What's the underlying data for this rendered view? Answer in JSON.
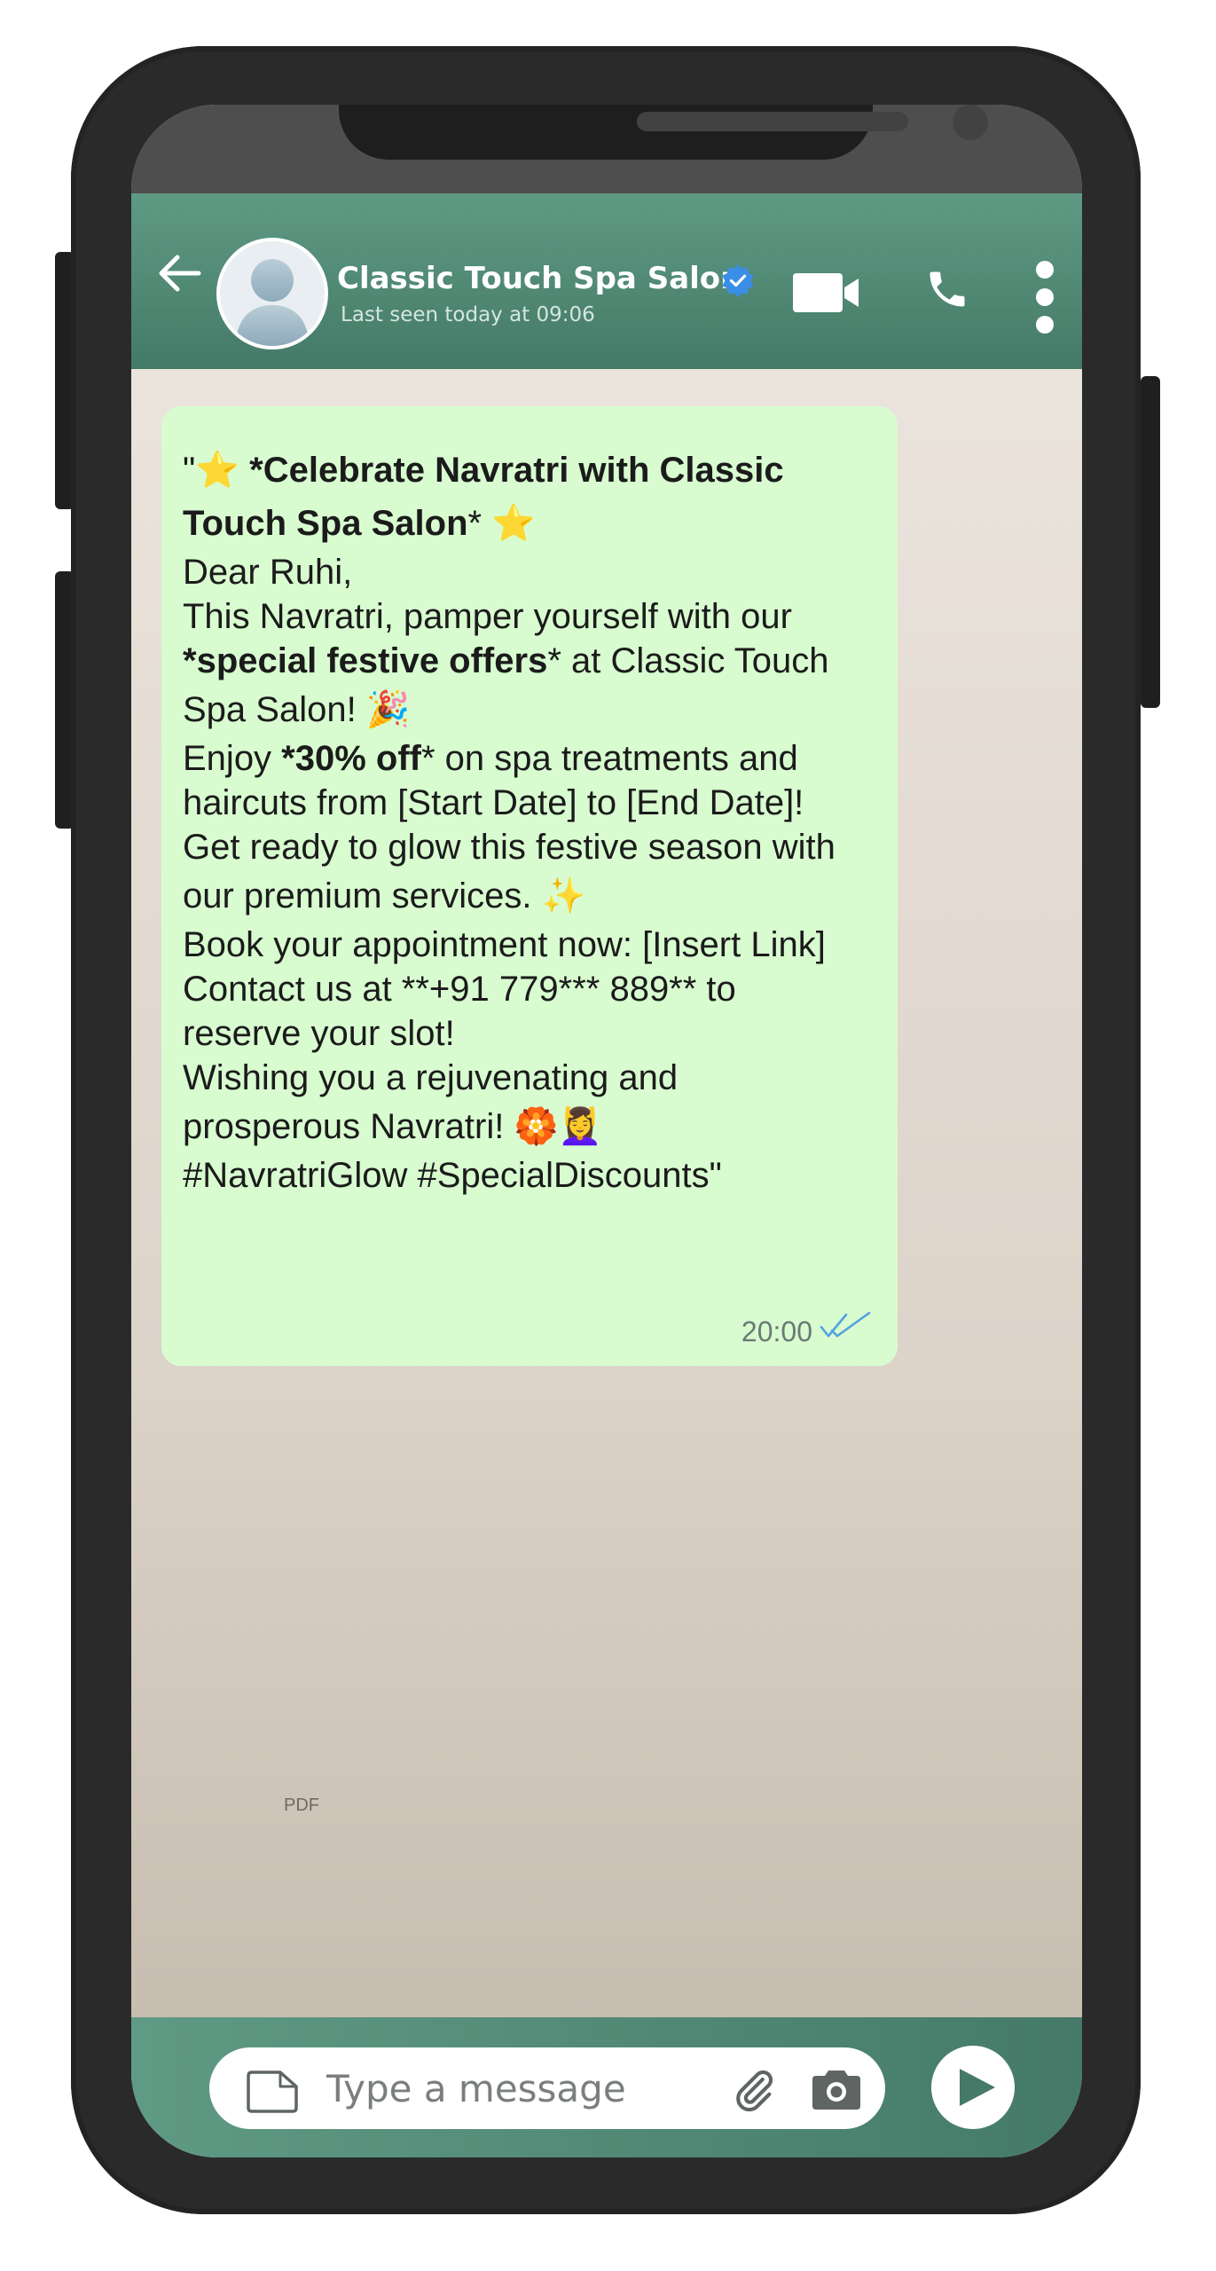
{
  "header": {
    "contact_name": "Classic Touch Spa Salon",
    "last_seen": "Last seen today at 09:06"
  },
  "message": {
    "lines": [
      {
        "parts": [
          {
            "t": "\""
          },
          {
            "t": "⭐",
            "emoji": true
          },
          {
            "t": " *Celebrate Navratri with Classic",
            "bold": true
          }
        ]
      },
      {
        "parts": [
          {
            "t": "Touch Spa Salon",
            "bold": true
          },
          {
            "t": "* "
          },
          {
            "t": "⭐",
            "emoji": true
          }
        ]
      },
      {
        "parts": [
          {
            "t": "Dear Ruhi,"
          }
        ]
      },
      {
        "parts": [
          {
            "t": "This Navratri, pamper yourself with our"
          }
        ]
      },
      {
        "parts": [
          {
            "t": "*special festive offers",
            "bold": true
          },
          {
            "t": "* at Classic Touch"
          }
        ]
      },
      {
        "parts": [
          {
            "t": "Spa Salon! "
          },
          {
            "t": "🎉",
            "emoji": true
          }
        ]
      },
      {
        "parts": [
          {
            "t": "Enjoy "
          },
          {
            "t": "*30% off",
            "bold": true
          },
          {
            "t": "* on spa treatments and"
          }
        ]
      },
      {
        "parts": [
          {
            "t": "haircuts from [Start Date] to [End Date]!"
          }
        ]
      },
      {
        "parts": [
          {
            "t": "Get ready to glow this festive season with"
          }
        ]
      },
      {
        "parts": [
          {
            "t": "our premium services. "
          },
          {
            "t": "✨",
            "emoji": true
          }
        ]
      },
      {
        "parts": [
          {
            "t": "Book your appointment now: [Insert Link]"
          }
        ]
      },
      {
        "parts": [
          {
            "t": "Contact us at **+91 779*** 889** to"
          }
        ]
      },
      {
        "parts": [
          {
            "t": "reserve your slot!"
          }
        ]
      },
      {
        "parts": [
          {
            "t": "Wishing you a rejuvenating and"
          }
        ]
      },
      {
        "parts": [
          {
            "t": "prosperous Navratri! "
          },
          {
            "t": "🏵️",
            "emoji": true
          },
          {
            "t": "💆‍♀️",
            "emoji": true
          }
        ]
      },
      {
        "parts": [
          {
            "t": "#NavratriGlow #SpecialDiscounts\""
          }
        ]
      }
    ],
    "time": "20:00",
    "status": "read"
  },
  "watermark": "PDF",
  "composer": {
    "placeholder": "Type a message"
  },
  "icons": {
    "back": "arrow-left-icon",
    "verified": "verified-check-icon",
    "video": "video-camera-icon",
    "call": "phone-call-icon",
    "menu": "more-vertical-icon",
    "attach_document": "document-icon",
    "attach": "paperclip-icon",
    "camera": "camera-icon",
    "send": "send-icon",
    "read_receipt": "double-check-icon"
  },
  "colors": {
    "header_green": "#5f9a84",
    "bubble_green": "#d8fcd0",
    "tick_blue": "#4fa3e0",
    "verified_blue": "#3a8ee6"
  }
}
